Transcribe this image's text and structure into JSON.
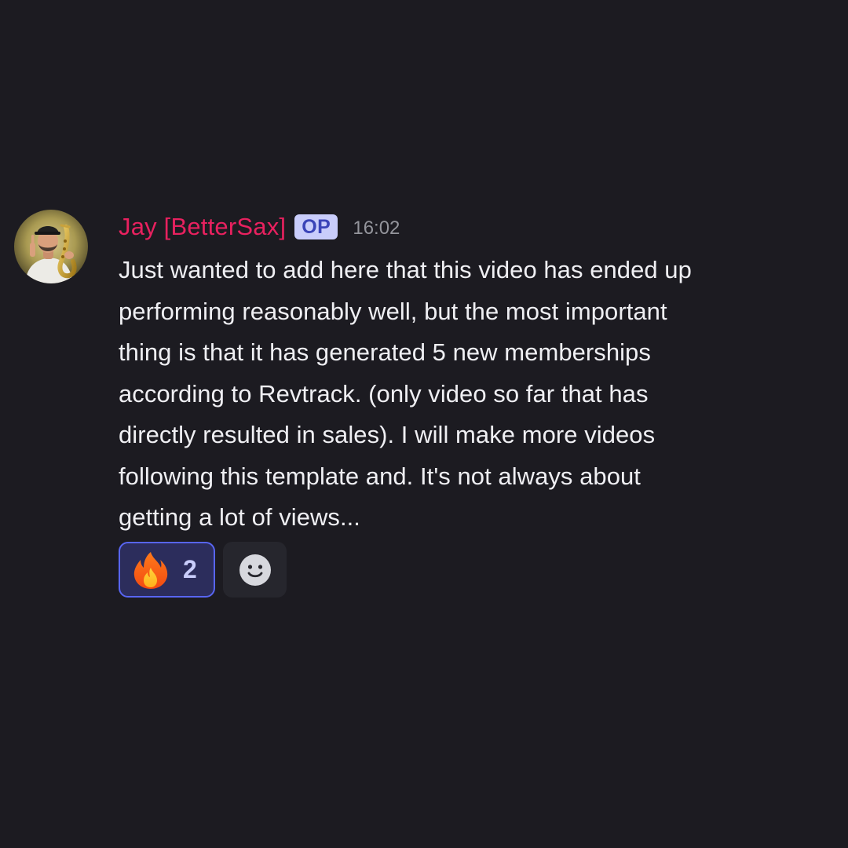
{
  "message": {
    "author": {
      "name": "Jay [BetterSax]",
      "name_color": "#e8215f",
      "badge": "OP",
      "avatar_icon": "user-avatar-saxophonist"
    },
    "timestamp": "16:02",
    "content": "Just wanted to add here that this video has ended up\nperforming reasonably well, but the most important\nthing is that it has generated 5 new memberships\naccording to Revtrack. (only video so far that has\ndirectly resulted in sales). I will make more videos\nfollowing this template and. It's not always about\ngetting a lot of views...",
    "reactions": [
      {
        "emoji_icon": "fire-emoji-icon",
        "count": "2",
        "active": true
      }
    ],
    "add_reaction_icon": "smiley-face-icon"
  },
  "colors": {
    "background": "#1c1b21",
    "text": "#efeff3",
    "timestamp": "#94959c",
    "accent": "#5865f2"
  }
}
